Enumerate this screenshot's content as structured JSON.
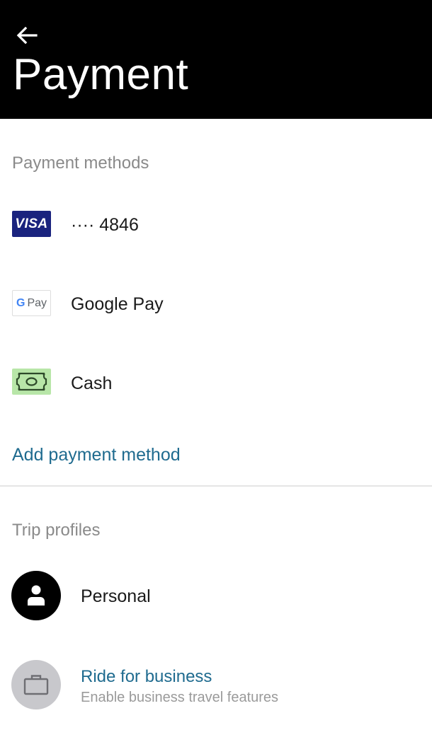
{
  "header": {
    "title": "Payment",
    "back_icon": "arrow-left-icon"
  },
  "payment_methods": {
    "section_title": "Payment methods",
    "items": [
      {
        "icon": "visa-card-icon",
        "icon_text": "VISA",
        "label": "···· 4846"
      },
      {
        "icon": "google-pay-icon",
        "icon_text_g": "G",
        "icon_text_pay": "Pay",
        "label": "Google Pay"
      },
      {
        "icon": "cash-icon",
        "label": "Cash"
      }
    ],
    "add_label": "Add payment method"
  },
  "trip_profiles": {
    "section_title": "Trip profiles",
    "personal": {
      "icon": "person-icon",
      "label": "Personal"
    },
    "business": {
      "icon": "briefcase-icon",
      "title": "Ride for business",
      "subtitle": "Enable business travel features"
    }
  },
  "colors": {
    "header_bg": "#000000",
    "link": "#1f6b8f",
    "visa_bg": "#1a237e",
    "cash_bg": "#b8e6a8",
    "section_title": "#8a8a8a"
  }
}
